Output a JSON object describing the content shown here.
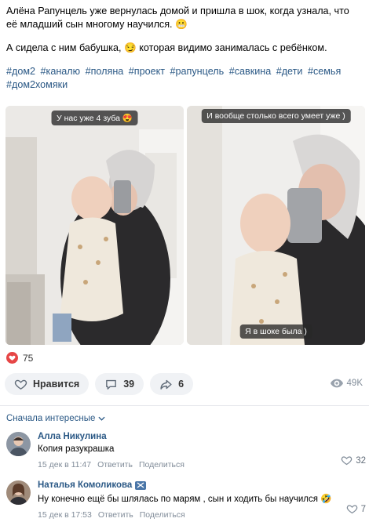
{
  "post": {
    "text_line1": "Алёна Рапунцель уже вернулась домой и пришла в шок, когда узнала, что её младший сын многому научился. 😬",
    "text_line2": "А сидела с ним бабушка, 😏 которая видимо занималась с ребёнком.",
    "hashtags": [
      "#дом2",
      "#каналю",
      "#поляна",
      "#проект",
      "#рапунцель",
      "#савкина",
      "#дети",
      "#семья",
      "#дом2хомяки"
    ]
  },
  "photos": [
    {
      "caption_top": "У нас уже 4 зуба 😍"
    },
    {
      "caption_top": "И вообще столько всего умеет уже )",
      "caption_bottom": "Я в шоке была )"
    }
  ],
  "reactions": {
    "count": "75"
  },
  "actions": {
    "like_label": "Нравится",
    "comments_count": "39",
    "shares_count": "6",
    "views_count": "49K"
  },
  "comments_section": {
    "sort_label": "Сначала интересные"
  },
  "comments": [
    {
      "author": "Алла Никулина",
      "text": "Копия разукрашка",
      "date": "15 дек в 11:47",
      "reply_label": "Ответить",
      "share_label": "Поделиться",
      "likes": "32"
    },
    {
      "author": "Наталья Комоликова",
      "text": "Ну конечно ещё бы шлялась по марям , сын и ходить бы научился 🤣",
      "date": "15 дек в 17:53",
      "reply_label": "Ответить",
      "share_label": "Поделиться",
      "likes": "7"
    }
  ],
  "colors": {
    "link": "#2a5885",
    "heart": "#e64646",
    "pill_bg": "#f0f2f5",
    "muted": "#818c99"
  }
}
